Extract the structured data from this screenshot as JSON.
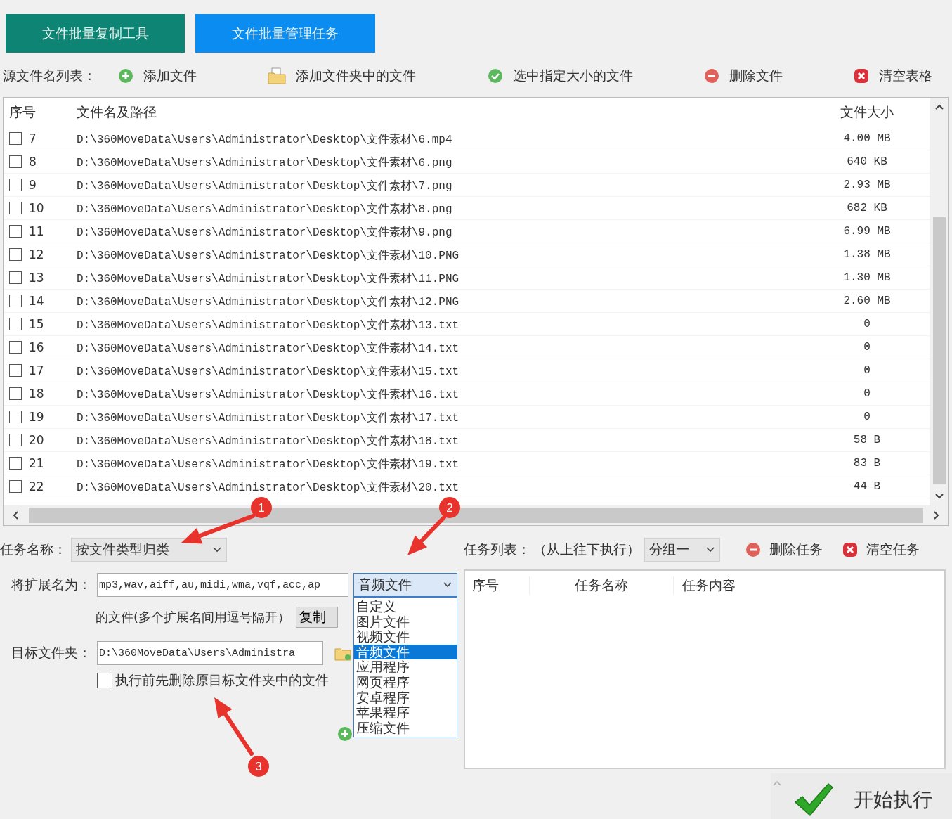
{
  "tabs": [
    {
      "label": "文件批量复制工具",
      "selected": false
    },
    {
      "label": "文件批量管理任务",
      "selected": true
    }
  ],
  "source_toolbar": {
    "label": "源文件名列表：",
    "actions": [
      {
        "label": "添加文件",
        "kind": "add"
      },
      {
        "label": "添加文件夹中的文件",
        "kind": "folder"
      },
      {
        "label": "选中指定大小的文件",
        "kind": "check"
      },
      {
        "label": "删除文件",
        "kind": "remove"
      },
      {
        "label": "清空表格",
        "kind": "clear"
      }
    ]
  },
  "file_table": {
    "columns": [
      "序号",
      "文件名及路径",
      "文件大小"
    ],
    "rows": [
      {
        "index": "7",
        "path": "D:\\360MoveData\\Users\\Administrator\\Desktop\\文件素材\\6.mp4",
        "size": "4.00 MB",
        "checked": false
      },
      {
        "index": "8",
        "path": "D:\\360MoveData\\Users\\Administrator\\Desktop\\文件素材\\6.png",
        "size": "640 KB",
        "checked": false
      },
      {
        "index": "9",
        "path": "D:\\360MoveData\\Users\\Administrator\\Desktop\\文件素材\\7.png",
        "size": "2.93 MB",
        "checked": false
      },
      {
        "index": "10",
        "path": "D:\\360MoveData\\Users\\Administrator\\Desktop\\文件素材\\8.png",
        "size": "682 KB",
        "checked": false
      },
      {
        "index": "11",
        "path": "D:\\360MoveData\\Users\\Administrator\\Desktop\\文件素材\\9.png",
        "size": "6.99 MB",
        "checked": false
      },
      {
        "index": "12",
        "path": "D:\\360MoveData\\Users\\Administrator\\Desktop\\文件素材\\10.PNG",
        "size": "1.38 MB",
        "checked": false
      },
      {
        "index": "13",
        "path": "D:\\360MoveData\\Users\\Administrator\\Desktop\\文件素材\\11.PNG",
        "size": "1.30 MB",
        "checked": false
      },
      {
        "index": "14",
        "path": "D:\\360MoveData\\Users\\Administrator\\Desktop\\文件素材\\12.PNG",
        "size": "2.60 MB",
        "checked": false
      },
      {
        "index": "15",
        "path": "D:\\360MoveData\\Users\\Administrator\\Desktop\\文件素材\\13.txt",
        "size": "0",
        "checked": false
      },
      {
        "index": "16",
        "path": "D:\\360MoveData\\Users\\Administrator\\Desktop\\文件素材\\14.txt",
        "size": "0",
        "checked": false
      },
      {
        "index": "17",
        "path": "D:\\360MoveData\\Users\\Administrator\\Desktop\\文件素材\\15.txt",
        "size": "0",
        "checked": false
      },
      {
        "index": "18",
        "path": "D:\\360MoveData\\Users\\Administrator\\Desktop\\文件素材\\16.txt",
        "size": "0",
        "checked": false
      },
      {
        "index": "19",
        "path": "D:\\360MoveData\\Users\\Administrator\\Desktop\\文件素材\\17.txt",
        "size": "0",
        "checked": false
      },
      {
        "index": "20",
        "path": "D:\\360MoveData\\Users\\Administrator\\Desktop\\文件素材\\18.txt",
        "size": "58 B",
        "checked": false
      },
      {
        "index": "21",
        "path": "D:\\360MoveData\\Users\\Administrator\\Desktop\\文件素材\\19.txt",
        "size": "83 B",
        "checked": false
      },
      {
        "index": "22",
        "path": "D:\\360MoveData\\Users\\Administrator\\Desktop\\文件素材\\20.txt",
        "size": "44 B",
        "checked": false
      }
    ]
  },
  "task_name": {
    "label": "任务名称：",
    "value": "按文件类型归类"
  },
  "extension": {
    "label": "将扩展名为：",
    "value": "mp3,wav,aiff,au,midi,wma,vqf,acc,ap",
    "type_select": {
      "value": "音频文件",
      "options": [
        {
          "label": "自定义",
          "selected": false
        },
        {
          "label": "图片文件",
          "selected": false
        },
        {
          "label": "视频文件",
          "selected": false
        },
        {
          "label": "音频文件",
          "selected": true
        },
        {
          "label": "应用程序",
          "selected": false
        },
        {
          "label": "网页程序",
          "selected": false
        },
        {
          "label": "安卓程序",
          "selected": false
        },
        {
          "label": "苹果程序",
          "selected": false
        },
        {
          "label": "压缩文件",
          "selected": false
        }
      ]
    }
  },
  "extension_hint": "的文件(多个扩展名间用逗号隔开）",
  "copy_button": "复制",
  "target_folder": {
    "label": "目标文件夹：",
    "value": "D:\\360MoveData\\Users\\Administra"
  },
  "delete_option": {
    "label": "执行前先删除原目标文件夹中的文件",
    "checked": false
  },
  "task_list": {
    "label": "任务列表：",
    "note": "（从上往下执行）",
    "group": "分组一",
    "actions": [
      {
        "label": "删除任务",
        "kind": "remove"
      },
      {
        "label": "清空任务",
        "kind": "clear"
      }
    ],
    "columns": [
      "序号",
      "任务名称",
      "任务内容"
    ]
  },
  "start_button": "开始执行",
  "annotations": [
    {
      "label": "1"
    },
    {
      "label": "2"
    },
    {
      "label": "3"
    }
  ]
}
